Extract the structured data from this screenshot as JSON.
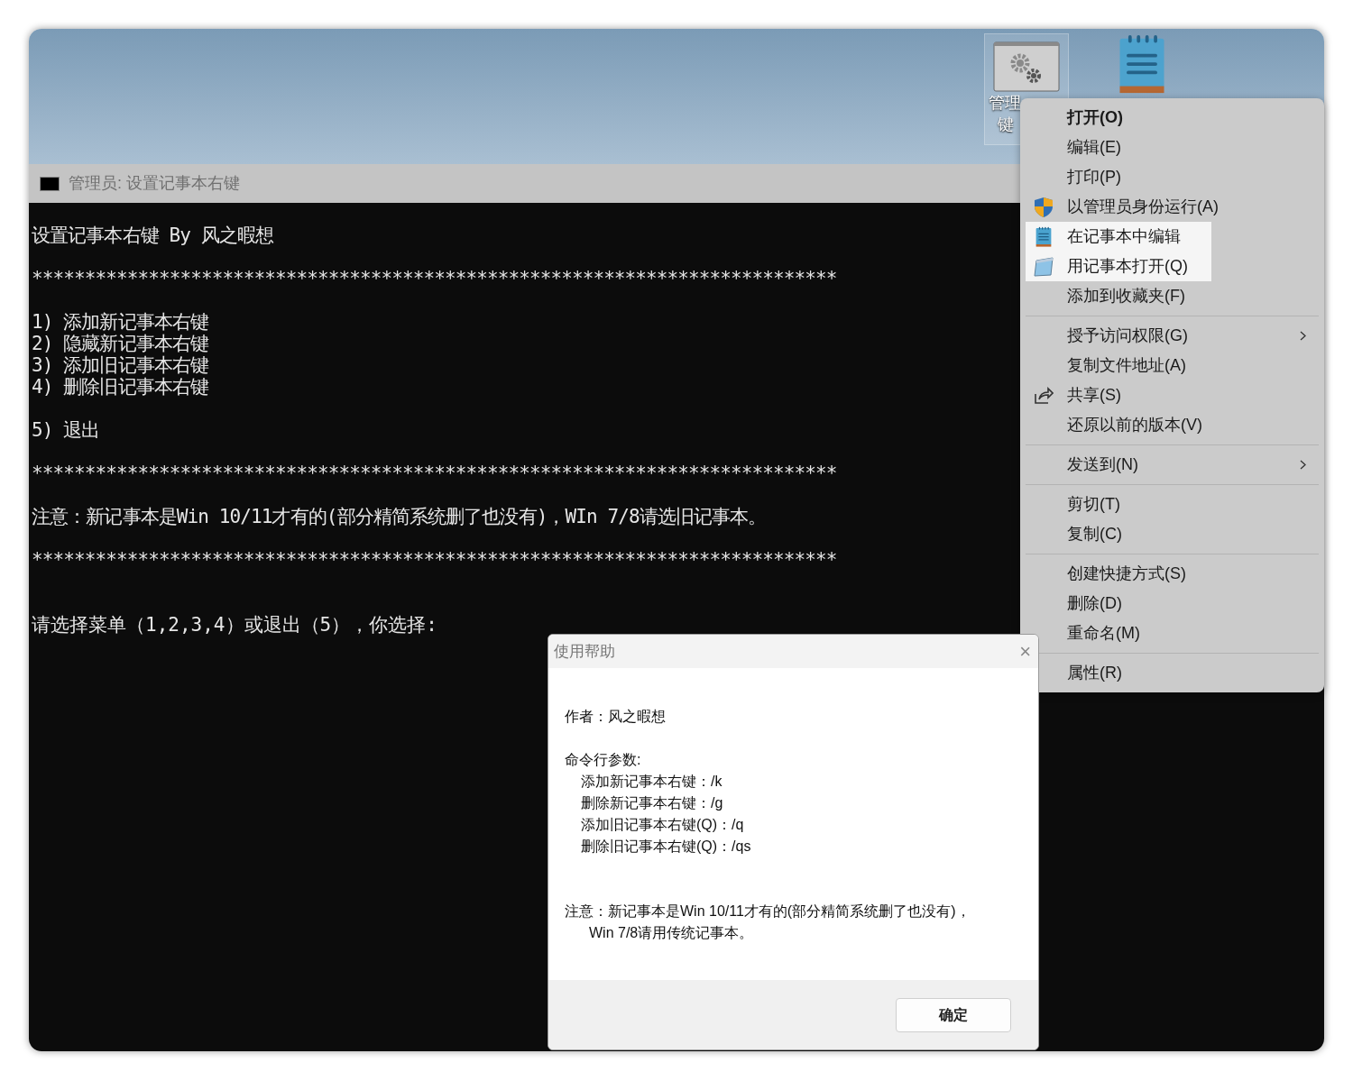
{
  "desktop": {
    "icons": [
      {
        "kind": "gears",
        "label_lines": [
          "管理",
          "键"
        ],
        "selected": true
      },
      {
        "kind": "notepad",
        "selected": false
      }
    ]
  },
  "console": {
    "title": "管理员:  设置记事本右键",
    "blocks": [
      [
        "设置记事本右键 By 风之暇想"
      ],
      [
        "****************************************************************************"
      ],
      [
        "1) 添加新记事本右键",
        "2) 隐藏新记事本右键",
        "3) 添加旧记事本右键",
        "4) 删除旧记事本右键"
      ],
      [
        "5) 退出"
      ],
      [
        "****************************************************************************"
      ],
      [
        "注意：新记事本是Win 10/11才有的(部分精简系统删了也没有)，WIn 7/8请选旧记事本。"
      ],
      [
        "****************************************************************************"
      ]
    ],
    "prompt": "请选择菜单（1,2,3,4）或退出（5），你选择:"
  },
  "context_menu": {
    "groups": [
      [
        {
          "label": "打开(O)",
          "kind": "plain",
          "default": true,
          "highlighted": false,
          "submenu": false
        },
        {
          "label": "编辑(E)",
          "kind": "plain",
          "default": false,
          "highlighted": false,
          "submenu": false
        },
        {
          "label": "打印(P)",
          "kind": "plain",
          "default": false,
          "highlighted": false,
          "submenu": false
        },
        {
          "label": "以管理员身份运行(A)",
          "kind": "admin",
          "default": false,
          "highlighted": false,
          "submenu": false
        },
        {
          "label": "在记事本中编辑",
          "kind": "notepad",
          "default": false,
          "highlighted": true,
          "submenu": false
        },
        {
          "label": "用记事本打开(Q)",
          "kind": "legacy",
          "default": false,
          "highlighted": true,
          "submenu": false
        },
        {
          "label": "添加到收藏夹(F)",
          "kind": "plain",
          "default": false,
          "highlighted": false,
          "submenu": false
        }
      ],
      [
        {
          "label": "授予访问权限(G)",
          "kind": "plain",
          "default": false,
          "highlighted": false,
          "submenu": true
        },
        {
          "label": "复制文件地址(A)",
          "kind": "plain",
          "default": false,
          "highlighted": false,
          "submenu": false
        },
        {
          "label": "共享(S)",
          "kind": "share",
          "default": false,
          "highlighted": false,
          "submenu": false
        },
        {
          "label": "还原以前的版本(V)",
          "kind": "plain",
          "default": false,
          "highlighted": false,
          "submenu": false
        }
      ],
      [
        {
          "label": "发送到(N)",
          "kind": "plain",
          "default": false,
          "highlighted": false,
          "submenu": true
        }
      ],
      [
        {
          "label": "剪切(T)",
          "kind": "plain",
          "default": false,
          "highlighted": false,
          "submenu": false
        },
        {
          "label": "复制(C)",
          "kind": "plain",
          "default": false,
          "highlighted": false,
          "submenu": false
        }
      ],
      [
        {
          "label": "创建快捷方式(S)",
          "kind": "plain",
          "default": false,
          "highlighted": false,
          "submenu": false
        },
        {
          "label": "删除(D)",
          "kind": "plain",
          "default": false,
          "highlighted": false,
          "submenu": false
        },
        {
          "label": "重命名(M)",
          "kind": "plain",
          "default": false,
          "highlighted": false,
          "submenu": false
        }
      ],
      [
        {
          "label": "属性(R)",
          "kind": "plain",
          "default": false,
          "highlighted": false,
          "submenu": false
        }
      ]
    ]
  },
  "help_dialog": {
    "title": "使用帮助",
    "close": "×",
    "paragraphs": [
      {
        "heading": "作者：风之暇想"
      },
      {
        "heading": "命令行参数:",
        "lines": [
          "添加新记事本右键：/k",
          "删除新记事本右键：/g",
          "添加旧记事本右键(Q)：/q",
          "删除旧记事本右键(Q)：/qs"
        ]
      },
      {
        "heading": "注意：新记事本是Win 10/11才有的(部分精简系统删了也没有)，",
        "lines": [
          "Win 7/8请用传统记事本。"
        ]
      }
    ],
    "ok_button": "确定"
  }
}
